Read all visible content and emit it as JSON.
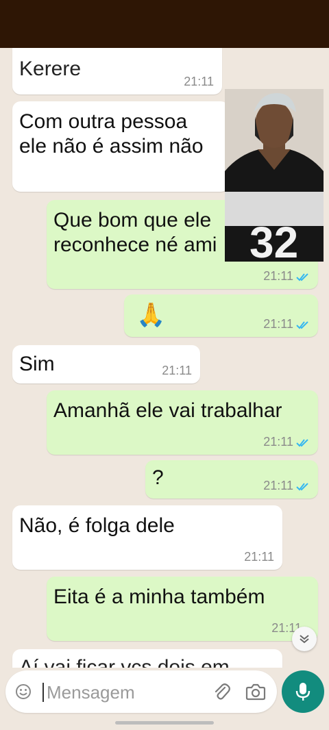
{
  "chat": {
    "top_partial": {
      "text": "Kerere",
      "time": "21:11"
    },
    "messages": [
      {
        "side": "in",
        "text": "Com outra pessoa\nele não é assim não",
        "time": "21:11"
      },
      {
        "side": "out",
        "text": "Que bom que ele\nreconhece né ami",
        "time": "21:11",
        "status": "read"
      },
      {
        "side": "out",
        "text": "🙏",
        "time": "21:11",
        "status": "read"
      },
      {
        "side": "in",
        "text": "Sim",
        "time": "21:11"
      },
      {
        "side": "out",
        "text": "Amanhã ele vai trabalhar",
        "time": "21:11",
        "status": "read"
      },
      {
        "side": "out",
        "text": "?",
        "time": "21:11",
        "status": "read"
      },
      {
        "side": "in",
        "text": "Não, é folga dele",
        "time": "21:11"
      },
      {
        "side": "out",
        "text": "Eita é a minha também",
        "time": "21:11",
        "status": "read"
      }
    ],
    "bottom_partial": {
      "text": "Aí vai ficar vcs dois em"
    }
  },
  "composer": {
    "placeholder": "Mensagem",
    "icons": {
      "emoji": "emoji-icon",
      "attach": "paperclip-icon",
      "camera": "camera-icon",
      "mic": "mic-icon"
    }
  },
  "overlay": {
    "jersey_number": "32"
  },
  "colors": {
    "top_bar": "#2e1605",
    "background": "#efe7de",
    "incoming_bubble": "#ffffff",
    "outgoing_bubble": "#dcf8c6",
    "read_tick": "#34b7f1",
    "mic_button": "#128c7e"
  }
}
